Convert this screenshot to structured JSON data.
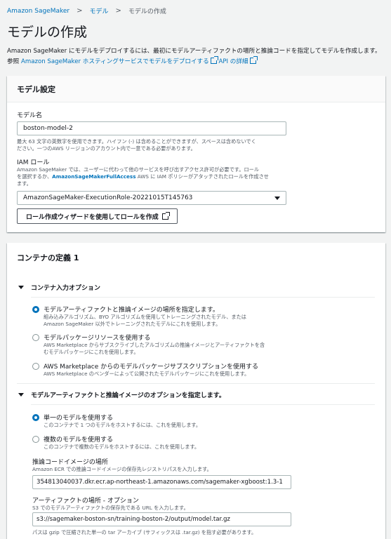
{
  "breadcrumb": {
    "items": [
      "Amazon SageMaker",
      "モデル",
      "モデルの作成"
    ],
    "separator": ">"
  },
  "page_title": "モデルの作成",
  "intro": {
    "text_before": "Amazon SageMaker にモデルをデプロイするには、最初にモデルアーティファクトの場所と推論コードを指定してモデルを作成します。 参照",
    "link1": "Amazon SageMaker ホスティングサービスでモデルをデプロイする",
    "link2": "API の詳細"
  },
  "model_settings": {
    "title": "モデル設定",
    "name_label": "モデル名",
    "name_value": "boston-model-2",
    "name_desc_line1": "最大 63 文字の英数字を使用できます。ハイフン (-) は含めることができますが、スペースは含めないでく",
    "name_desc_line2": "ださい。一つのAWS リージョンのアカウント内で一意である必要があります。",
    "iam_label": "IAM ロール",
    "iam_desc_line1": "Amazon SageMaker では、ユーザーに代わって他のサービスを呼び出すアクセス許可が必要です。ロール",
    "iam_desc_line2_pre": "を選択するか、",
    "iam_desc_line2_link": "AmazonSageMakerFullAccess",
    "iam_desc_line2_post": " AWS に IAM ポリシーがアタッチされたロールを作成させ",
    "iam_desc_line3": "ます。",
    "iam_value": "AmazonSageMaker-ExecutionRole-20221015T145763",
    "wizard_button": "ロール作成ウィザードを使用してロールを作成"
  },
  "container": {
    "title": "コンテナの定義 1",
    "input_options": {
      "title": "コンテナ入力オプション",
      "options": [
        {
          "title": "モデルアーティファクトと推論イメージの場所を指定します。",
          "desc1": "組み込みアルゴリズム、BYO アルゴリズムを使用してトレーニングされたモデル、または",
          "desc2": "Amazon SageMaker 以外でトレーニングされたモデルにこれを使用します。",
          "checked": true
        },
        {
          "title": "モデルパッケージリソースを使用する",
          "desc1": "AWS Marketplace からサブスクライブしたアルゴリズムの推論イメージとアーティファクトを含",
          "desc2": "むモデルパッケージにこれを使用します。",
          "checked": false
        },
        {
          "title": "AWS Marketplace からのモデルパッケージサブスクリプションを使用する",
          "desc1": "AWS Marketplace のベンダーによって公開されたモデルパッケージにこれを使用します。",
          "desc2": "",
          "checked": false
        }
      ]
    },
    "artifact_options": {
      "title": "モデルアーティファクトと推論イメージのオプションを指定します。",
      "options": [
        {
          "title": "単一のモデルを使用する",
          "desc": "このコンテナで 1 つのモデルをホストするには、これを使用します。",
          "checked": true
        },
        {
          "title": "複数のモデルを使用する",
          "desc": "このコンテナで複数のモデルをホストするには、これを使用します。",
          "checked": false
        }
      ],
      "image_label": "推論コードイメージの場所",
      "image_desc": "Amazon ECR での推論コードイメージの保存先レジストリパスを入力します。",
      "image_value": "354813040037.dkr.ecr.ap-northeast-1.amazonaws.com/sagemaker-xgboost:1.3-1",
      "artifact_label": "アーティファクトの場所 - オプション",
      "artifact_desc": "S3 でのモデルアーティファクトの保存先である URL を入力します。",
      "artifact_value": "s3://sagemaker-boston-sn/training-boston-2/output/model.tar.gz",
      "artifact_footer": "パスは gzip で圧縮された単一の tar アーカイブ (サフィックスは .tar.gz) を指す必要があります。"
    }
  },
  "colors": {
    "link": "#0073bb",
    "accent_radio": "#0073bb",
    "background": "#f2f3f3"
  }
}
